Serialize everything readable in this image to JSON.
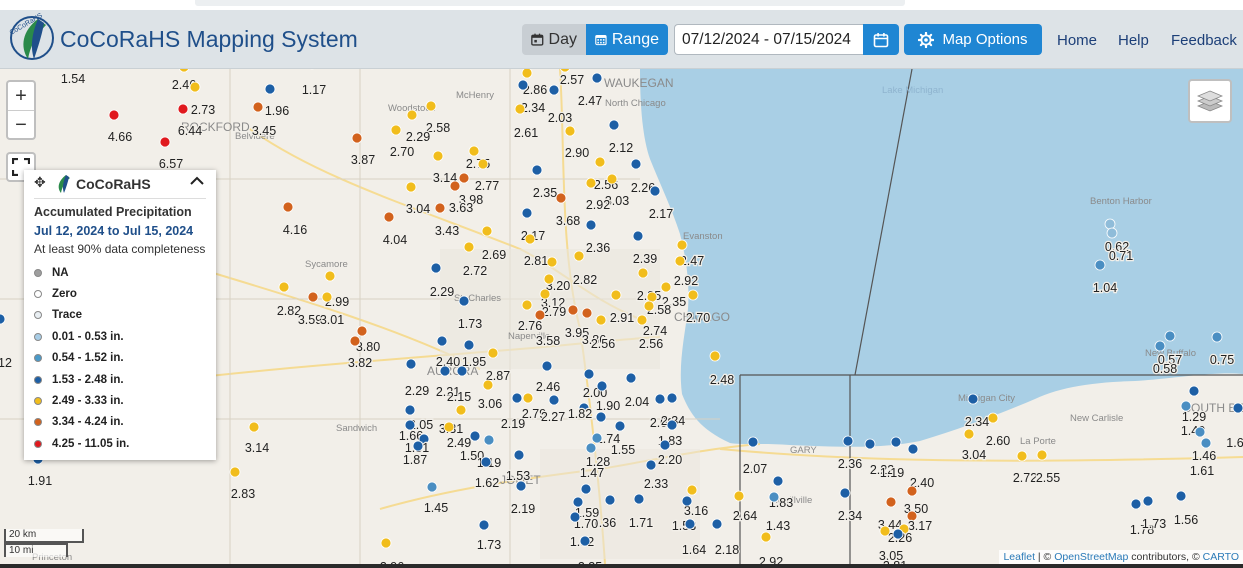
{
  "header": {
    "title": "CoCoRaHS Mapping System",
    "logo_text": "CoCoRaHS",
    "day_label": "Day",
    "range_label": "Range",
    "date_range": "07/12/2024 - 07/15/2024",
    "map_options_label": "Map Options",
    "nav": {
      "home": "Home",
      "help": "Help",
      "feedback": "Feedback"
    }
  },
  "colors": {
    "header_bg": "#dde3e7",
    "accent": "#1f86d3",
    "title": "#1f4f8a",
    "lake": "#a9cfe5",
    "light_blue": "#8fbcd9",
    "mid_blue": "#4a8ec2",
    "dark_blue": "#1d5fa5",
    "yellow": "#f1bd1c",
    "orange": "#d2621d",
    "red": "#e0191e"
  },
  "zoom": {
    "in": "+",
    "out": "−"
  },
  "legend": {
    "brand": "CoCoRaHS",
    "title": "Accumulated Precipitation",
    "dates": "Jul 12, 2024 to Jul 15, 2024",
    "subtitle": "At least 90% data completeness",
    "items": [
      {
        "label": "NA",
        "color": "#9e9e9e"
      },
      {
        "label": "Zero",
        "color": "#ffffff"
      },
      {
        "label": "Trace",
        "color": "#e8eef2"
      },
      {
        "label": "0.01 - 0.53 in.",
        "color": "#a8cde6"
      },
      {
        "label": "0.54 - 1.52 in.",
        "color": "#4a9ac9"
      },
      {
        "label": "1.53 - 2.48 in.",
        "color": "#1d5fa5"
      },
      {
        "label": "2.49 - 3.33 in.",
        "color": "#f1bd1c"
      },
      {
        "label": "3.34 - 4.24 in.",
        "color": "#d2621d"
      },
      {
        "label": "4.25 - 11.05 in.",
        "color": "#e0191e"
      }
    ]
  },
  "scale": {
    "km": "20 km",
    "mi": "10 mi"
  },
  "attribution": {
    "leaflet": "Leaflet",
    "sep": " | © ",
    "osm": "OpenStreetMap",
    "contrib": " contributors, © ",
    "carto": "CARTO"
  },
  "places": [
    "WAUKEGAN",
    "North Chicago",
    "McHenry",
    "Woodstock",
    "Belvidere",
    "ROCKFORD",
    "Sycamore",
    "St. Charles",
    "Naperville",
    "JOLIET",
    "AURORA",
    "Sandwich",
    "Evanston",
    "CHICAGO",
    "GARY",
    "Merrillville",
    "Michigan City",
    "La Porte",
    "SOUTH BEND",
    "Benton Harbor",
    "New Buffalo",
    "New Carlisle",
    "Lake Michigan",
    "Princeton"
  ],
  "stations": [
    {
      "v": "1.54",
      "c": "db"
    },
    {
      "v": "2.46",
      "c": "y"
    },
    {
      "v": "2.73",
      "c": "y"
    },
    {
      "v": "1.96",
      "c": "db"
    },
    {
      "v": "1.17",
      "c": "db"
    },
    {
      "v": "4.66",
      "c": "r"
    },
    {
      "v": "6.44",
      "c": "r"
    },
    {
      "v": "6.57",
      "c": "r"
    },
    {
      "v": "3.45",
      "c": "o"
    },
    {
      "v": "2.86",
      "c": "y"
    },
    {
      "v": "2.57",
      "c": "y"
    },
    {
      "v": "2.47",
      "c": "db"
    },
    {
      "v": "2.34",
      "c": "db"
    },
    {
      "v": "2.03",
      "c": "db"
    },
    {
      "v": "2.61",
      "c": "y"
    },
    {
      "v": "2.58",
      "c": "y"
    },
    {
      "v": "2.29",
      "c": "y"
    },
    {
      "v": "2.70",
      "c": "y"
    },
    {
      "v": "3.87",
      "c": "o"
    },
    {
      "v": "2.12",
      "c": "db"
    },
    {
      "v": "2.90",
      "c": "y"
    },
    {
      "v": "2.75",
      "c": "y"
    },
    {
      "v": "3.14",
      "c": "y"
    },
    {
      "v": "2.77",
      "c": "y"
    },
    {
      "v": "3.98",
      "c": "o"
    },
    {
      "v": "3.63",
      "c": "o"
    },
    {
      "v": "3.04",
      "c": "y"
    },
    {
      "v": "2.35",
      "c": "db"
    },
    {
      "v": "2.56",
      "c": "y"
    },
    {
      "v": "3.03",
      "c": "y"
    },
    {
      "v": "2.26",
      "c": "db"
    },
    {
      "v": "2.92",
      "c": "y"
    },
    {
      "v": "3.68",
      "c": "o"
    },
    {
      "v": "2.17",
      "c": "db"
    },
    {
      "v": "4.16",
      "c": "o"
    },
    {
      "v": "4.04",
      "c": "o"
    },
    {
      "v": "3.43",
      "c": "o"
    },
    {
      "v": "2.17",
      "c": "db"
    },
    {
      "v": "2.36",
      "c": "db"
    },
    {
      "v": "2.81",
      "c": "y"
    },
    {
      "v": "2.69",
      "c": "y"
    },
    {
      "v": "2.72",
      "c": "y"
    },
    {
      "v": "2.39",
      "c": "db"
    },
    {
      "v": "2.47",
      "c": "y"
    },
    {
      "v": "2.92",
      "c": "y"
    },
    {
      "v": "2.29",
      "c": "db"
    },
    {
      "v": "3.20",
      "c": "y"
    },
    {
      "v": "2.82",
      "c": "y"
    },
    {
      "v": "3.12",
      "c": "y"
    },
    {
      "v": "2.85",
      "c": "y"
    },
    {
      "v": "2.35",
      "c": "y"
    },
    {
      "v": "2.58",
      "c": "y"
    },
    {
      "v": "2.99",
      "c": "y"
    },
    {
      "v": "2.82",
      "c": "y"
    },
    {
      "v": "3.59",
      "c": "o"
    },
    {
      "v": "3.01",
      "c": "y"
    },
    {
      "v": "2.79",
      "c": "y"
    },
    {
      "v": "2.91",
      "c": "y"
    },
    {
      "v": "2.70",
      "c": "y"
    },
    {
      "v": "1.73",
      "c": "db"
    },
    {
      "v": "2.76",
      "c": "y"
    },
    {
      "v": "3.58",
      "c": "o"
    },
    {
      "v": "3.95",
      "c": "o"
    },
    {
      "v": "3.86",
      "c": "o"
    },
    {
      "v": "2.74",
      "c": "y"
    },
    {
      "v": "2.56",
      "c": "y"
    },
    {
      "v": "3.80",
      "c": "o"
    },
    {
      "v": "3.82",
      "c": "o"
    },
    {
      "v": "2.40",
      "c": "db"
    },
    {
      "v": "1.95",
      "c": "db"
    },
    {
      "v": "2.87",
      "c": "y"
    },
    {
      "v": "2.48",
      "c": "y"
    },
    {
      "v": "2.29",
      "c": "db"
    },
    {
      "v": "2.21",
      "c": "db"
    },
    {
      "v": "2.46",
      "c": "db"
    },
    {
      "v": "2.00",
      "c": "db"
    },
    {
      "v": "2.15",
      "c": "db"
    },
    {
      "v": "1.90",
      "c": "db"
    },
    {
      "v": "2.04",
      "c": "db"
    },
    {
      "v": "3.06",
      "c": "y"
    },
    {
      "v": "2.19",
      "c": "db"
    },
    {
      "v": "2.79",
      "c": "y"
    },
    {
      "v": "2.27",
      "c": "db"
    },
    {
      "v": "1.82",
      "c": "db"
    },
    {
      "v": "2.02",
      "c": "db"
    },
    {
      "v": "2.34",
      "c": "db"
    },
    {
      "v": "2.05",
      "c": "db"
    },
    {
      "v": "3.31",
      "c": "y"
    },
    {
      "v": "1.66",
      "c": "db"
    },
    {
      "v": "1.74",
      "c": "db"
    },
    {
      "v": "1.55",
      "c": "db"
    },
    {
      "v": "1.83",
      "c": "db"
    },
    {
      "v": "1.51",
      "c": "db"
    },
    {
      "v": "2.49",
      "c": "y"
    },
    {
      "v": "1.87",
      "c": "db"
    },
    {
      "v": "1.50",
      "c": "db"
    },
    {
      "v": "1.19",
      "c": "mb"
    },
    {
      "v": "1.28",
      "c": "mb"
    },
    {
      "v": "2.20",
      "c": "db"
    },
    {
      "v": "1.47",
      "c": "mb"
    },
    {
      "v": "1.53",
      "c": "db"
    },
    {
      "v": "1.62",
      "c": "db"
    },
    {
      "v": "2.33",
      "c": "db"
    },
    {
      "v": "2.07",
      "c": "db"
    },
    {
      "v": "3.14",
      "c": "y"
    },
    {
      "v": "1.91",
      "c": "db"
    },
    {
      "v": "2.83",
      "c": "y"
    },
    {
      "v": "1.45",
      "c": "mb"
    },
    {
      "v": "2.19",
      "c": "db"
    },
    {
      "v": "1.59",
      "c": "db"
    },
    {
      "v": "1.36",
      "c": "db"
    },
    {
      "v": "3.16",
      "c": "y"
    },
    {
      "v": "1.83",
      "c": "db"
    },
    {
      "v": "1.70",
      "c": "db"
    },
    {
      "v": "1.71",
      "c": "db"
    },
    {
      "v": "1.53",
      "c": "db"
    },
    {
      "v": "2.64",
      "c": "y"
    },
    {
      "v": "1.43",
      "c": "mb"
    },
    {
      "v": "1.82",
      "c": "db"
    },
    {
      "v": "1.73",
      "c": "db"
    },
    {
      "v": "1.64",
      "c": "db"
    },
    {
      "v": "2.18",
      "c": "db"
    },
    {
      "v": "2.92",
      "c": "y"
    },
    {
      "v": "2.35",
      "c": "db"
    },
    {
      "v": "2.96",
      "c": "y"
    },
    {
      "v": "2.36",
      "c": "db"
    },
    {
      "v": "2.22",
      "c": "db"
    },
    {
      "v": "1.19",
      "c": "db"
    },
    {
      "v": "2.40",
      "c": "db"
    },
    {
      "v": "3.04",
      "c": "y"
    },
    {
      "v": "2.34",
      "c": "db"
    },
    {
      "v": "2.60",
      "c": "y"
    },
    {
      "v": "2.72",
      "c": "y"
    },
    {
      "v": "2.55",
      "c": "y"
    },
    {
      "v": "2.34",
      "c": "db"
    },
    {
      "v": "3.50",
      "c": "o"
    },
    {
      "v": "3.44",
      "c": "o"
    },
    {
      "v": "3.17",
      "c": "o"
    },
    {
      "v": "2.26",
      "c": "y"
    },
    {
      "v": "3.05",
      "c": "y"
    },
    {
      "v": "2.81",
      "c": "db"
    },
    {
      "v": "0.62",
      "c": "lb"
    },
    {
      "v": "0.71",
      "c": "lb"
    },
    {
      "v": "1.04",
      "c": "mb"
    },
    {
      "v": "0.57",
      "c": "mb"
    },
    {
      "v": "0.75",
      "c": "mb"
    },
    {
      "v": "0.58",
      "c": "mb"
    },
    {
      "v": "1.29",
      "c": "db"
    },
    {
      "v": "1.40",
      "c": "mb"
    },
    {
      "v": "1.46",
      "c": "mb"
    },
    {
      "v": "1.61",
      "c": "mb"
    },
    {
      "v": "1.78",
      "c": "db"
    },
    {
      "v": "1.73",
      "c": "db"
    },
    {
      "v": "1.56",
      "c": "db"
    },
    {
      "v": "1.6",
      "c": "db"
    },
    {
      "v": "12",
      "c": "db"
    },
    {
      "v": "2.56",
      "c": "y"
    }
  ]
}
